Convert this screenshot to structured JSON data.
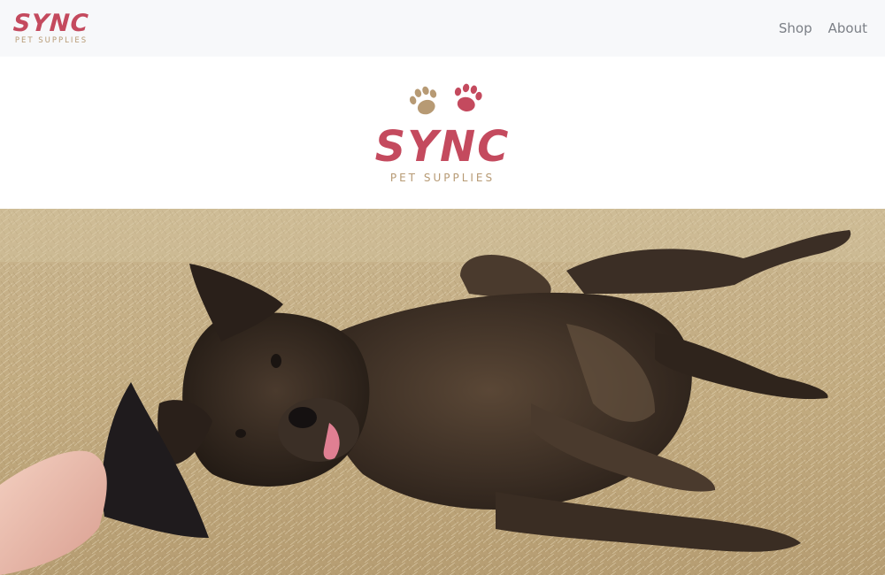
{
  "navbar": {
    "brand": {
      "word": "SYNC",
      "sub": "PET SUPPLIES"
    },
    "links": [
      {
        "label": "Shop"
      },
      {
        "label": "About"
      }
    ]
  },
  "hero": {
    "logo_word": "SYNC",
    "logo_sub": "PET SUPPLIES"
  },
  "colors": {
    "brand_red": "#c44a5e",
    "brand_tan": "#b79a74",
    "navbar_bg": "#f7f8fa",
    "nav_link": "#7b7f86"
  },
  "photo": {
    "subject": "brindle-dog-on-grass"
  }
}
